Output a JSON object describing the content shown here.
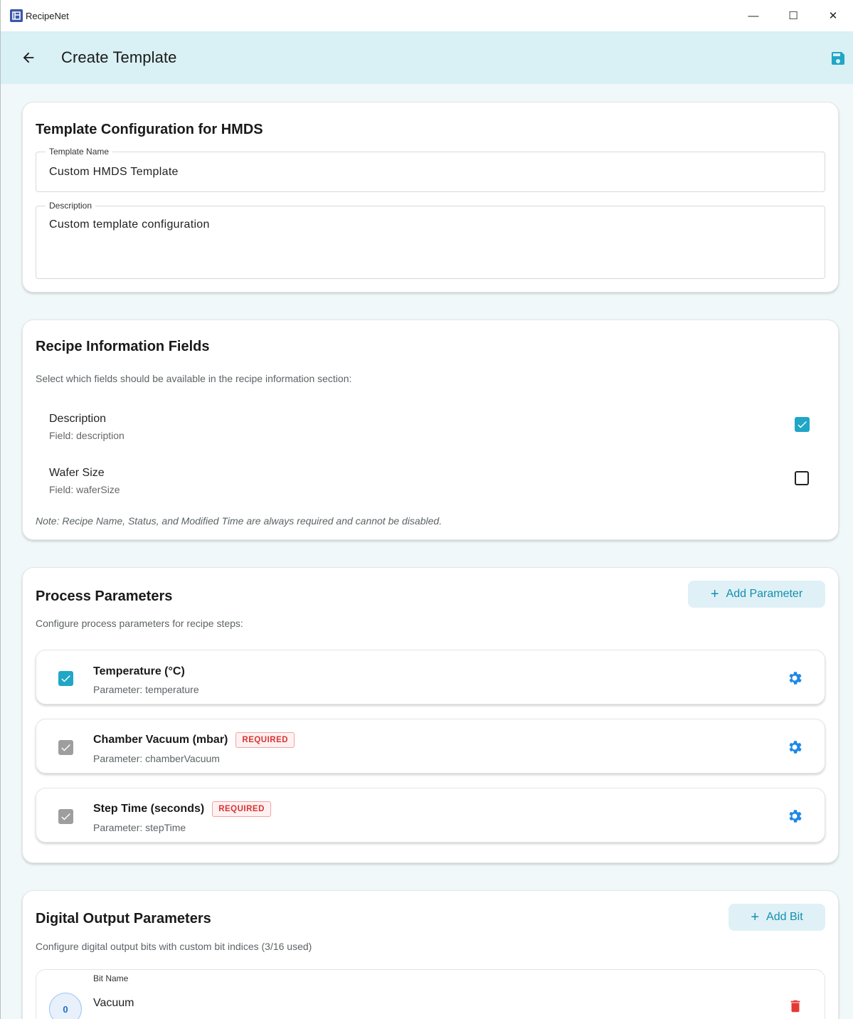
{
  "window": {
    "app_title": "RecipeNet",
    "minimize": "—",
    "maximize": "☐",
    "close": "✕"
  },
  "appbar": {
    "title": "Create Template"
  },
  "template_config": {
    "title": "Template Configuration for HMDS",
    "name_label": "Template Name",
    "name_value": "Custom HMDS Template",
    "description_label": "Description",
    "description_value": "Custom template configuration"
  },
  "recipe_info": {
    "title": "Recipe Information Fields",
    "subtitle": "Select which fields should be available in the recipe information section:",
    "fields": [
      {
        "name": "Description",
        "field": "Field: description",
        "checked": true
      },
      {
        "name": "Wafer Size",
        "field": "Field: waferSize",
        "checked": false
      }
    ],
    "note": "Note: Recipe Name, Status, and Modified Time are always required and cannot be disabled."
  },
  "process_params": {
    "title": "Process Parameters",
    "add_label": "Add Parameter",
    "subtitle": "Configure process parameters for recipe steps:",
    "items": [
      {
        "name": "Temperature (°C)",
        "key": "Parameter: temperature",
        "checked": true,
        "required": false,
        "badge": ""
      },
      {
        "name": "Chamber Vacuum (mbar)",
        "key": "Parameter: chamberVacuum",
        "checked": true,
        "required": true,
        "badge": "REQUIRED"
      },
      {
        "name": "Step Time (seconds)",
        "key": "Parameter: stepTime",
        "checked": true,
        "required": true,
        "badge": "REQUIRED"
      }
    ]
  },
  "digital_outputs": {
    "title": "Digital Output Parameters",
    "add_label": "Add Bit",
    "subtitle": "Configure digital output bits with custom bit indices (3/16 used)",
    "bits": [
      {
        "index": "0",
        "label": "Bit Name",
        "value": "Vacuum"
      }
    ]
  },
  "colors": {
    "accent": "#20a6c7",
    "appbar_bg": "#d9f0f4",
    "gear": "#1e88e5",
    "delete": "#e53935",
    "required_badge": "#d93333"
  },
  "icons": {
    "back": "arrow-left-icon",
    "save": "floppy-disk-icon",
    "settings": "gear-icon",
    "delete": "trash-icon"
  }
}
